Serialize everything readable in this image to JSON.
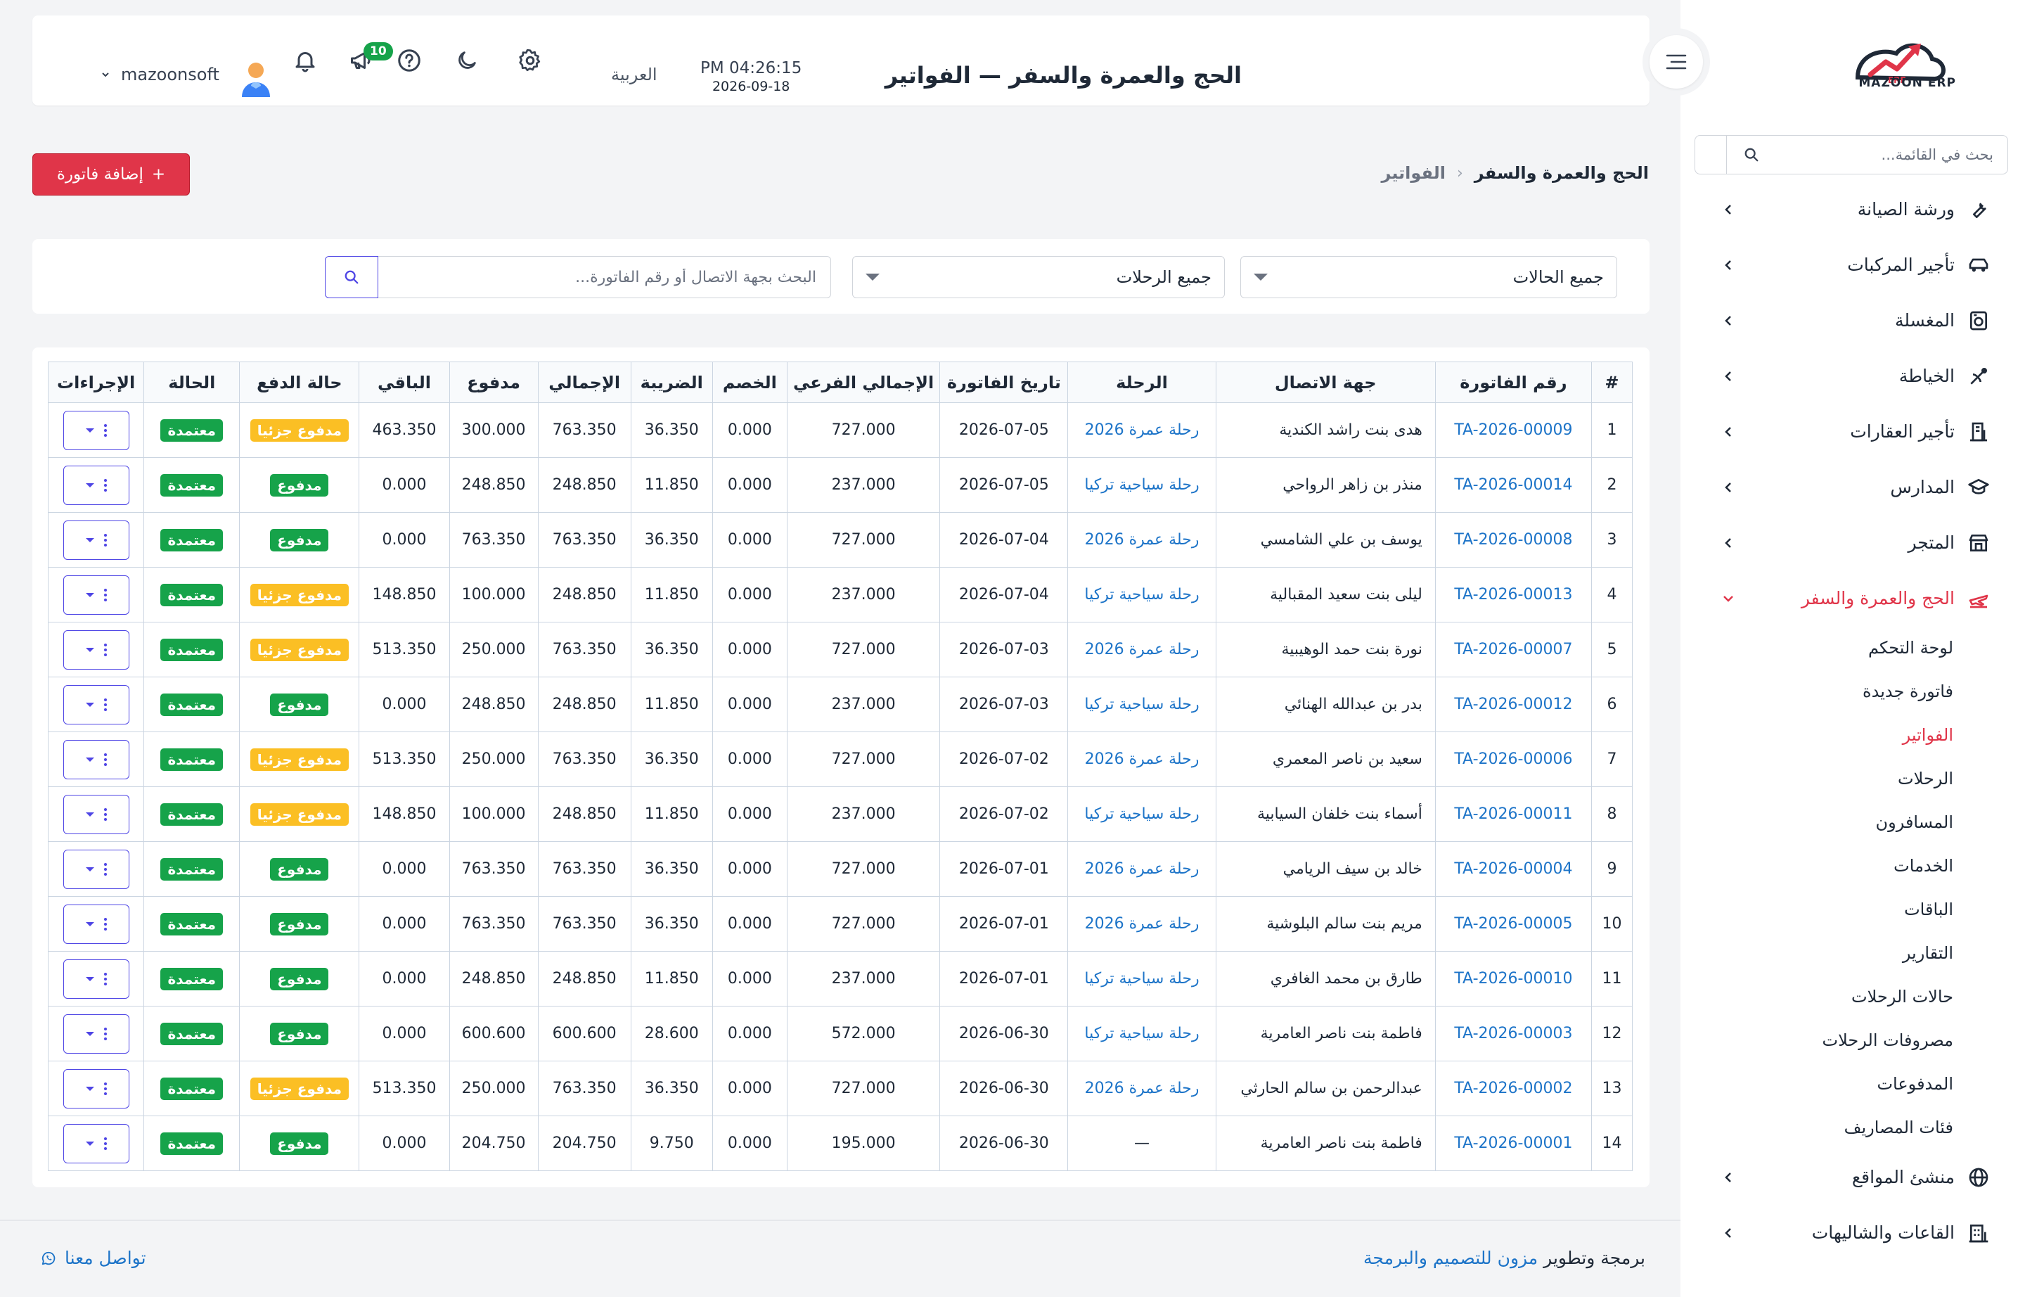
{
  "app": {
    "logo_text": "MAZOON ERP",
    "title": "الحج والعمرة والسفر — الفواتير"
  },
  "header": {
    "time": "PM 04:26:15",
    "date": "2026-09-18",
    "language": "العربية",
    "notifications_count": "10",
    "username": "mazoonsoft"
  },
  "sidebar": {
    "search_placeholder": "بحث في القائمة...",
    "items": [
      {
        "label": "ورشة الصيانة",
        "icon": "wrench-icon"
      },
      {
        "label": "تأجير المركبات",
        "icon": "car-icon"
      },
      {
        "label": "المغسلة",
        "icon": "washing-machine-icon"
      },
      {
        "label": "الخياطة",
        "icon": "sewing-icon"
      },
      {
        "label": "تأجير العقارات",
        "icon": "building-icon"
      },
      {
        "label": "المدارس",
        "icon": "graduation-cap-icon"
      },
      {
        "label": "المتجر",
        "icon": "store-icon"
      },
      {
        "label": "الحج والعمرة والسفر",
        "icon": "plane-icon",
        "active": true
      }
    ],
    "subitems": [
      "لوحة التحكم",
      "فاتورة جديدة",
      "الفواتير",
      "الرحلات",
      "المسافرون",
      "الخدمات",
      "الباقات",
      "التقارير",
      "حالات الرحلات",
      "مصروفات الرحلات",
      "المدفوعات",
      "فئات المصاريف"
    ],
    "active_subitem": "الفواتير",
    "items_after": [
      {
        "label": "منشئ المواقع",
        "icon": "globe-icon"
      },
      {
        "label": "القاعات والشاليهات",
        "icon": "hall-icon"
      }
    ]
  },
  "breadcrumb": {
    "section": "الحج والعمرة والسفر",
    "page": "الفواتير"
  },
  "actions": {
    "add_invoice": "إضافة فاتورة",
    "add_symbol": "+"
  },
  "filters": {
    "status_selected": "جميع الحالات",
    "trip_selected": "جميع الرحلات",
    "search_placeholder": "البحث بجهة الاتصال أو رقم الفاتورة..."
  },
  "table": {
    "columns": [
      "#",
      "رقم الفاتورة",
      "جهة الاتصال",
      "الرحلة",
      "تاريخ الفاتورة",
      "الإجمالي الفرعي",
      "الخصم",
      "الضريبة",
      "الإجمالي",
      "مدفوع",
      "الباقي",
      "حالة الدفع",
      "الحالة",
      "الإجراءات"
    ],
    "rows": [
      {
        "n": "1",
        "invoice": "TA-2026-00009",
        "contact": "هدى بنت راشد الكندية",
        "trip": "رحلة عمرة 2026",
        "date": "2026-07-05",
        "subtotal": "727.000",
        "discount": "0.000",
        "tax": "36.350",
        "total": "763.350",
        "paid": "300.000",
        "remaining": "463.350",
        "payment_status": "مدفوع جزئيا",
        "partial": true,
        "status": "معتمدة"
      },
      {
        "n": "2",
        "invoice": "TA-2026-00014",
        "contact": "منذر بن زاهر الرواحي",
        "trip": "رحلة سياحية تركيا",
        "date": "2026-07-05",
        "subtotal": "237.000",
        "discount": "0.000",
        "tax": "11.850",
        "total": "248.850",
        "paid": "248.850",
        "remaining": "0.000",
        "payment_status": "مدفوع",
        "partial": false,
        "status": "معتمدة"
      },
      {
        "n": "3",
        "invoice": "TA-2026-00008",
        "contact": "يوسف بن علي الشامسي",
        "trip": "رحلة عمرة 2026",
        "date": "2026-07-04",
        "subtotal": "727.000",
        "discount": "0.000",
        "tax": "36.350",
        "total": "763.350",
        "paid": "763.350",
        "remaining": "0.000",
        "payment_status": "مدفوع",
        "partial": false,
        "status": "معتمدة"
      },
      {
        "n": "4",
        "invoice": "TA-2026-00013",
        "contact": "ليلى بنت سعيد المقبالية",
        "trip": "رحلة سياحية تركيا",
        "date": "2026-07-04",
        "subtotal": "237.000",
        "discount": "0.000",
        "tax": "11.850",
        "total": "248.850",
        "paid": "100.000",
        "remaining": "148.850",
        "payment_status": "مدفوع جزئيا",
        "partial": true,
        "status": "معتمدة"
      },
      {
        "n": "5",
        "invoice": "TA-2026-00007",
        "contact": "نورة بنت حمد الوهيبية",
        "trip": "رحلة عمرة 2026",
        "date": "2026-07-03",
        "subtotal": "727.000",
        "discount": "0.000",
        "tax": "36.350",
        "total": "763.350",
        "paid": "250.000",
        "remaining": "513.350",
        "payment_status": "مدفوع جزئيا",
        "partial": true,
        "status": "معتمدة"
      },
      {
        "n": "6",
        "invoice": "TA-2026-00012",
        "contact": "بدر بن عبدالله الهنائي",
        "trip": "رحلة سياحية تركيا",
        "date": "2026-07-03",
        "subtotal": "237.000",
        "discount": "0.000",
        "tax": "11.850",
        "total": "248.850",
        "paid": "248.850",
        "remaining": "0.000",
        "payment_status": "مدفوع",
        "partial": false,
        "status": "معتمدة"
      },
      {
        "n": "7",
        "invoice": "TA-2026-00006",
        "contact": "سعيد بن ناصر المعمري",
        "trip": "رحلة عمرة 2026",
        "date": "2026-07-02",
        "subtotal": "727.000",
        "discount": "0.000",
        "tax": "36.350",
        "total": "763.350",
        "paid": "250.000",
        "remaining": "513.350",
        "payment_status": "مدفوع جزئيا",
        "partial": true,
        "status": "معتمدة"
      },
      {
        "n": "8",
        "invoice": "TA-2026-00011",
        "contact": "أسماء بنت خلفان السيابية",
        "trip": "رحلة سياحية تركيا",
        "date": "2026-07-02",
        "subtotal": "237.000",
        "discount": "0.000",
        "tax": "11.850",
        "total": "248.850",
        "paid": "100.000",
        "remaining": "148.850",
        "payment_status": "مدفوع جزئيا",
        "partial": true,
        "status": "معتمدة"
      },
      {
        "n": "9",
        "invoice": "TA-2026-00004",
        "contact": "خالد بن سيف الريامي",
        "trip": "رحلة عمرة 2026",
        "date": "2026-07-01",
        "subtotal": "727.000",
        "discount": "0.000",
        "tax": "36.350",
        "total": "763.350",
        "paid": "763.350",
        "remaining": "0.000",
        "payment_status": "مدفوع",
        "partial": false,
        "status": "معتمدة"
      },
      {
        "n": "10",
        "invoice": "TA-2026-00005",
        "contact": "مريم بنت سالم البلوشية",
        "trip": "رحلة عمرة 2026",
        "date": "2026-07-01",
        "subtotal": "727.000",
        "discount": "0.000",
        "tax": "36.350",
        "total": "763.350",
        "paid": "763.350",
        "remaining": "0.000",
        "payment_status": "مدفوع",
        "partial": false,
        "status": "معتمدة"
      },
      {
        "n": "11",
        "invoice": "TA-2026-00010",
        "contact": "طارق بن محمد الغافري",
        "trip": "رحلة سياحية تركيا",
        "date": "2026-07-01",
        "subtotal": "237.000",
        "discount": "0.000",
        "tax": "11.850",
        "total": "248.850",
        "paid": "248.850",
        "remaining": "0.000",
        "payment_status": "مدفوع",
        "partial": false,
        "status": "معتمدة"
      },
      {
        "n": "12",
        "invoice": "TA-2026-00003",
        "contact": "فاطمة بنت ناصر العامرية",
        "trip": "رحلة سياحية تركيا",
        "date": "2026-06-30",
        "subtotal": "572.000",
        "discount": "0.000",
        "tax": "28.600",
        "total": "600.600",
        "paid": "600.600",
        "remaining": "0.000",
        "payment_status": "مدفوع",
        "partial": false,
        "status": "معتمدة"
      },
      {
        "n": "13",
        "invoice": "TA-2026-00002",
        "contact": "عبدالرحمن بن سالم الحارثي",
        "trip": "رحلة عمرة 2026",
        "date": "2026-06-30",
        "subtotal": "727.000",
        "discount": "0.000",
        "tax": "36.350",
        "total": "763.350",
        "paid": "250.000",
        "remaining": "513.350",
        "payment_status": "مدفوع جزئيا",
        "partial": true,
        "status": "معتمدة"
      },
      {
        "n": "14",
        "invoice": "TA-2026-00001",
        "contact": "فاطمة بنت ناصر العامرية",
        "trip": "—",
        "date": "2026-06-30",
        "subtotal": "195.000",
        "discount": "0.000",
        "tax": "9.750",
        "total": "204.750",
        "paid": "204.750",
        "remaining": "0.000",
        "payment_status": "مدفوع",
        "partial": false,
        "status": "معتمدة"
      }
    ]
  },
  "footer": {
    "credit_prefix": "برمجة وتطوير",
    "company": "مزون للتصميم والبرمجة",
    "contact_us": "تواصل معنا"
  },
  "colors": {
    "accent_red": "#e03549",
    "link_blue": "#1d74c8",
    "success_green": "#16a34a",
    "warning_yellow": "#fbbf24",
    "action_indigo": "#4f46e5"
  }
}
